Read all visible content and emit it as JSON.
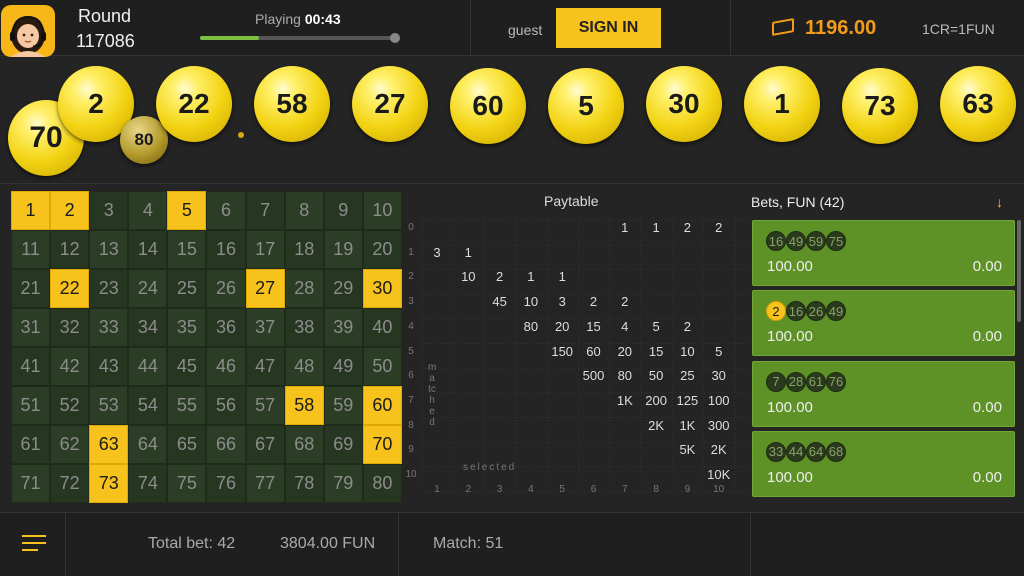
{
  "header": {
    "round_label": "Round",
    "round_number": "117086",
    "playing_label": "Playing",
    "playing_time": "00:43",
    "progress_fraction": 0.3,
    "guest_label": "guest",
    "signin_label": "SIGN IN",
    "balance": "1196.00",
    "rate": "1CR=1FUN",
    "icons": [
      "support-agent-icon",
      "cash-icon"
    ]
  },
  "drawn_balls": [
    "70",
    "2",
    "80",
    "22",
    "58",
    "27",
    "60",
    "5",
    "30",
    "1",
    "73",
    "63"
  ],
  "grid": {
    "numbers": [
      "1",
      "2",
      "3",
      "4",
      "5",
      "6",
      "7",
      "8",
      "9",
      "10",
      "11",
      "12",
      "13",
      "14",
      "15",
      "16",
      "17",
      "18",
      "19",
      "20",
      "21",
      "22",
      "23",
      "24",
      "25",
      "26",
      "27",
      "28",
      "29",
      "30",
      "31",
      "32",
      "33",
      "34",
      "35",
      "36",
      "37",
      "38",
      "39",
      "40",
      "41",
      "42",
      "43",
      "44",
      "45",
      "46",
      "47",
      "48",
      "49",
      "50",
      "51",
      "52",
      "53",
      "54",
      "55",
      "56",
      "57",
      "58",
      "59",
      "60",
      "61",
      "62",
      "63",
      "64",
      "65",
      "66",
      "67",
      "68",
      "69",
      "70",
      "71",
      "72",
      "73",
      "74",
      "75",
      "76",
      "77",
      "78",
      "79",
      "80"
    ],
    "hits": [
      1,
      2,
      5,
      22,
      27,
      30,
      58,
      60,
      63,
      70,
      73
    ]
  },
  "paytable": {
    "title": "Paytable",
    "selected_label": "selected",
    "matched_label": "matched",
    "row_labels": [
      "0",
      "1",
      "2",
      "3",
      "4",
      "5",
      "6",
      "7",
      "8",
      "9",
      "10"
    ],
    "col_labels": [
      "1",
      "2",
      "3",
      "4",
      "5",
      "6",
      "7",
      "8",
      "9",
      "10"
    ],
    "rows": [
      [
        "",
        "",
        "",
        "",
        "",
        "",
        "1",
        "1",
        "2",
        "2"
      ],
      [
        "3",
        "1",
        "",
        "",
        "",
        "",
        "",
        "",
        "",
        ""
      ],
      [
        "",
        "10",
        "2",
        "1",
        "1",
        "",
        "",
        "",
        "",
        ""
      ],
      [
        "",
        "",
        "45",
        "10",
        "3",
        "2",
        "2",
        "",
        "",
        ""
      ],
      [
        "",
        "",
        "",
        "80",
        "20",
        "15",
        "4",
        "5",
        "2",
        ""
      ],
      [
        "",
        "",
        "",
        "",
        "150",
        "60",
        "20",
        "15",
        "10",
        "5"
      ],
      [
        "",
        "",
        "",
        "",
        "",
        "500",
        "80",
        "50",
        "25",
        "30"
      ],
      [
        "",
        "",
        "",
        "",
        "",
        "",
        "1K",
        "200",
        "125",
        "100"
      ],
      [
        "",
        "",
        "",
        "",
        "",
        "",
        "",
        "2K",
        "1K",
        "300"
      ],
      [
        "",
        "",
        "",
        "",
        "",
        "",
        "",
        "",
        "5K",
        "2K"
      ],
      [
        "",
        "",
        "",
        "",
        "",
        "",
        "",
        "",
        "",
        "10K"
      ]
    ]
  },
  "bets": {
    "title": "Bets, FUN (42)",
    "items": [
      {
        "numbers": [
          "16",
          "49",
          "59",
          "75"
        ],
        "hits": [],
        "amount": "100.00",
        "win": "0.00"
      },
      {
        "numbers": [
          "2",
          "16",
          "26",
          "49"
        ],
        "hits": [
          "2"
        ],
        "amount": "100.00",
        "win": "0.00"
      },
      {
        "numbers": [
          "7",
          "28",
          "61",
          "76"
        ],
        "hits": [],
        "amount": "100.00",
        "win": "0.00"
      },
      {
        "numbers": [
          "33",
          "44",
          "64",
          "68"
        ],
        "hits": [],
        "amount": "100.00",
        "win": "0.00"
      }
    ]
  },
  "footer": {
    "total_bet_label": "Total bet: 42",
    "total_amount": "3804.00 FUN",
    "match_label": "Match: 51"
  },
  "colors": {
    "accent": "#f7c21b",
    "balance": "#f39c1a",
    "bet_card": "#5e9226",
    "grid_cell": "#273621"
  }
}
